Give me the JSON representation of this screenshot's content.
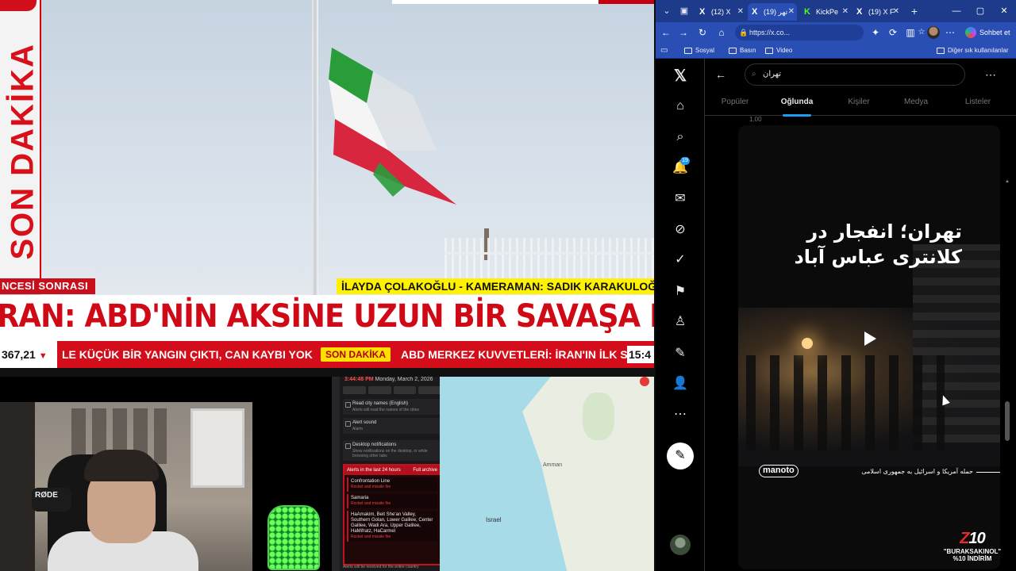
{
  "broadcast": {
    "side_banner": "SON DAKİKA",
    "strip_left": "NCESİ SONRASI",
    "strip_right": "İLAYDA ÇOLAKOĞLU - KAMERAMAN: SADIK KARAKULOĞLU",
    "headline": "RAN: ABD'NİN AKSİNE UZUN BİR SAVAŞA HAZIRIZ",
    "ticker": {
      "index_value": "367,21",
      "item1": "LE KÜÇÜK BİR YANGIN ÇIKTI, CAN KAYBI YOK",
      "badge": "SON DAKİKA",
      "item2": "ABD MERKEZ KUVVETLERİ: İRAN'IN İLK SA",
      "clock": "15:4"
    }
  },
  "webcam": {
    "mic_label": "RØDE"
  },
  "alerts_panel": {
    "time": "3:44:48 PM",
    "date": "Monday, March 2, 2026",
    "options": [
      {
        "title": "Read city names (English)",
        "desc": "Alerts will read the names of the cities"
      },
      {
        "title": "Alert sound",
        "desc": "Alarm"
      },
      {
        "title": "Desktop notifications",
        "desc": "Show notifications on the desktop, or while browsing other tabs"
      }
    ],
    "box_title": "Alerts in the last 24 hours",
    "box_link": "Full archive",
    "items": [
      {
        "title": "Confrontation Line",
        "sub": "Rocket and missile fire"
      },
      {
        "title": "Samaria",
        "sub": "Rocket and missile fire"
      },
      {
        "title": "HaAmakim, Beit She'an Valley, Southern Golan, Lower Galilee, Center Galilee, Wadi Ara, Upper Galilee, HaMifratz, HaCarmel",
        "sub": "Rocket and missile fire"
      }
    ],
    "footer": "Alerts will be received for the entire country"
  },
  "map": {
    "labels": {
      "israel": "Israel",
      "amman": "Amman"
    }
  },
  "browser": {
    "tabs": [
      {
        "favicon": "X",
        "label": "(12) X"
      },
      {
        "favicon": "X",
        "label": "(19) تهر"
      },
      {
        "favicon": "K",
        "label": "KickPe"
      },
      {
        "favicon": "X",
        "label": "(19) X F"
      }
    ],
    "url": "https://x.co...",
    "copilot_label": "Sohbet et",
    "favorites": [
      {
        "label": "Sosyal"
      },
      {
        "label": "Basın"
      },
      {
        "label": "Video"
      }
    ],
    "other_favorites": "Diğer sık kullanılanlar"
  },
  "x": {
    "search_query": "تهران",
    "notification_count": "19",
    "tabs": [
      {
        "label": "Popüler",
        "active": false
      },
      {
        "label": "Oğlunda",
        "active": true
      },
      {
        "label": "Kişiler",
        "active": false
      },
      {
        "label": "Medya",
        "active": false
      },
      {
        "label": "Listeler",
        "active": false
      }
    ],
    "feed_top_text": "1.00",
    "video": {
      "title": "تهران؛ انفجار در کلانتری عباس آباد",
      "logo": "manoto",
      "caption": "حمله آمریکا و اسرائیل به جمهوری اسلامی"
    }
  },
  "watermark": {
    "logo_prefix": "Z",
    "logo_suffix": "10",
    "line1": "\"BURAKSAKINOL\"",
    "line2": "%10 İNDİRİM"
  },
  "colors": {
    "news_red": "#cf0a16",
    "ticker_red": "#d30d19",
    "credit_yellow": "#fff200",
    "browser_blue": "#2a4fb4",
    "x_blue": "#1d9bf0"
  }
}
